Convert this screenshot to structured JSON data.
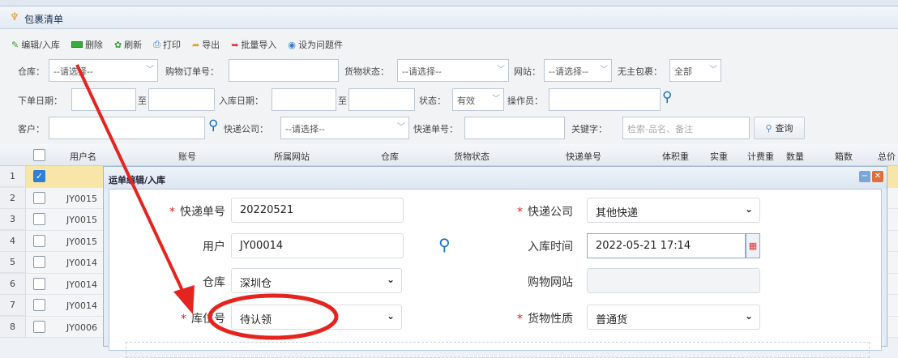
{
  "window": {
    "title": "包裹清单"
  },
  "toolbar": {
    "items": [
      {
        "label": "编辑/入库",
        "icon": "pencil-icon"
      },
      {
        "label": "删除",
        "icon": "delete-icon"
      },
      {
        "label": "刷新",
        "icon": "refresh-icon"
      },
      {
        "label": "打印",
        "icon": "print-icon"
      },
      {
        "label": "导出",
        "icon": "export-icon"
      },
      {
        "label": "批量导入",
        "icon": "import-icon"
      },
      {
        "label": "设为问题件",
        "icon": "flag-icon"
      }
    ]
  },
  "filters": {
    "warehouse_label": "仓库：",
    "warehouse_value": "--请选择--",
    "order_no_label": "购物订单号：",
    "goods_status_label": "货物状态：",
    "goods_status_value": "--请选择--",
    "site_label": "网站：",
    "site_value": "--请选择--",
    "unowned_label": "无主包裹：",
    "unowned_value": "全部",
    "order_date_label": "下单日期：",
    "to1": "至",
    "instock_date_label": "入库日期：",
    "to2": "至",
    "status_label": "状态：",
    "status_value": "有效",
    "operator_label": "操作员：",
    "customer_label": "客户：",
    "courier_label": "快递公司：",
    "courier_value": "--请选择--",
    "tracking_label": "快递单号：",
    "keyword_label": "关键字：",
    "keyword_placeholder": "检索-品名、备注",
    "query_button": "查询"
  },
  "grid": {
    "columns": [
      "用户名",
      "账号",
      "所属网站",
      "仓库",
      "货物状态",
      "快递单号",
      "体积重",
      "实重",
      "计费重",
      "数量",
      "箱数",
      "总价"
    ],
    "rows": [
      {
        "n": "1",
        "user": "",
        "checked": true
      },
      {
        "n": "2",
        "user": "JY0015"
      },
      {
        "n": "3",
        "user": "JY0015"
      },
      {
        "n": "4",
        "user": "JY0015"
      },
      {
        "n": "5",
        "user": "JY0014"
      },
      {
        "n": "6",
        "user": "JY0014"
      },
      {
        "n": "7",
        "user": "JY0014"
      },
      {
        "n": "8",
        "user": "JY0006"
      }
    ]
  },
  "dialog": {
    "title": "运单编辑/入库",
    "tracking_label": "快递单号",
    "tracking_value": "20220521",
    "courier_label": "快递公司",
    "courier_value": "其他快递",
    "user_label": "用户",
    "user_value": "JY00014",
    "instock_time_label": "入库时间",
    "instock_time_value": "2022-05-21 17:14",
    "warehouse_label": "仓库",
    "warehouse_value": "深圳仓",
    "shop_site_label": "购物网站",
    "location_label": "库位号",
    "location_value": "待认领",
    "goods_type_label": "货物性质",
    "goods_type_value": "普通货"
  },
  "colors": {
    "annotation": "#e52420",
    "accent": "#1b6ec2"
  }
}
